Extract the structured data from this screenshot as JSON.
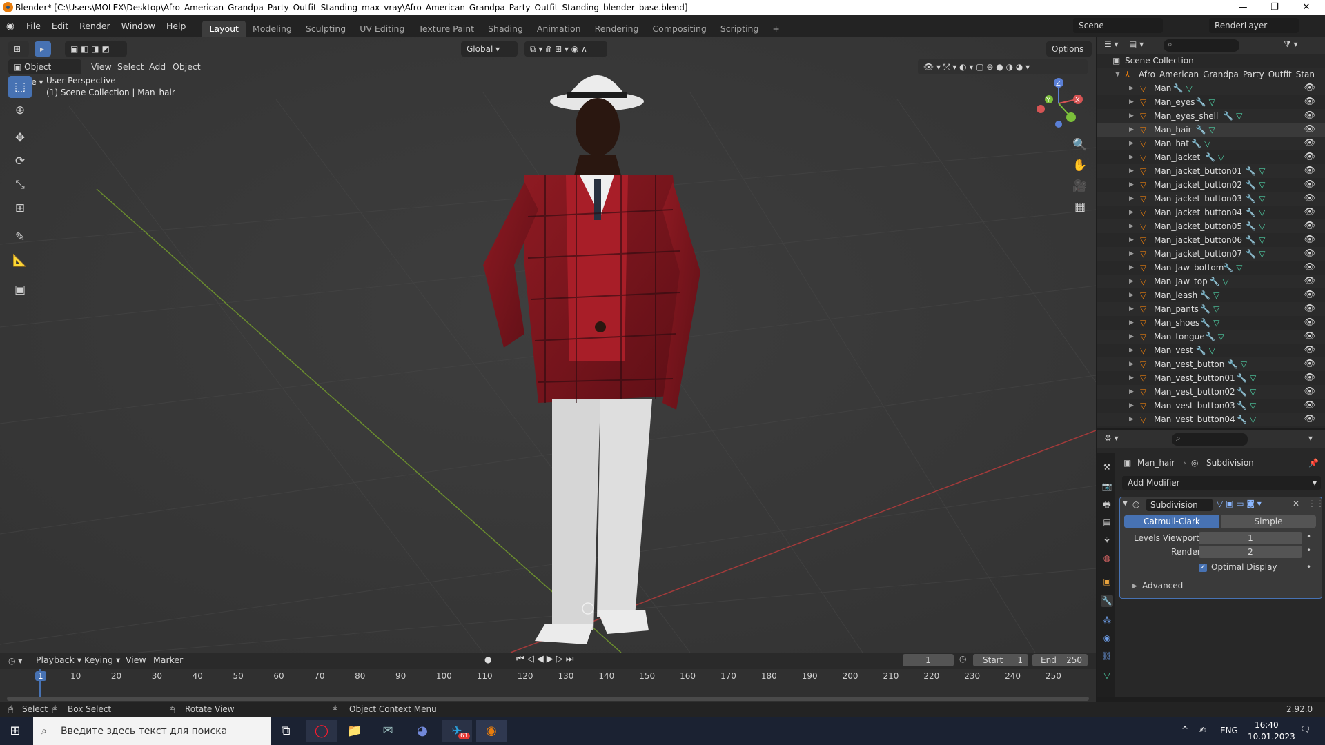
{
  "window": {
    "title": "Blender* [C:\\Users\\MOLEX\\Desktop\\Afro_American_Grandpa_Party_Outfit_Standing_max_vray\\Afro_American_Grandpa_Party_Outfit_Standing_blender_base.blend]",
    "minimize": "—",
    "maximize": "❐",
    "close": "✕"
  },
  "menu": {
    "items": [
      "File",
      "Edit",
      "Render",
      "Window",
      "Help"
    ],
    "workspaces": [
      "Layout",
      "Modeling",
      "Sculpting",
      "UV Editing",
      "Texture Paint",
      "Shading",
      "Animation",
      "Rendering",
      "Compositing",
      "Scripting"
    ],
    "add_workspace": "+",
    "scene": "Scene",
    "render_layer": "RenderLayer"
  },
  "viewport": {
    "orientation": "Global",
    "options": "Options",
    "mode": "Object Mode",
    "view_menu": [
      "View",
      "Select",
      "Add",
      "Object"
    ],
    "perspective": "User Perspective",
    "collection_info": "(1) Scene Collection | Man_hair",
    "gizmo": {
      "x": "X",
      "y": "Y",
      "z": "Z"
    }
  },
  "outliner": {
    "root": "Scene Collection",
    "collection": "Afro_American_Grandpa_Party_Outfit_Standi",
    "objects": [
      "Man",
      "Man_eyes",
      "Man_eyes_shell",
      "Man_hair",
      "Man_hat",
      "Man_jacket",
      "Man_jacket_button01",
      "Man_jacket_button02",
      "Man_jacket_button03",
      "Man_jacket_button04",
      "Man_jacket_button05",
      "Man_jacket_button06",
      "Man_jacket_button07",
      "Man_Jaw_bottom",
      "Man_Jaw_top",
      "Man_leash",
      "Man_pants",
      "Man_shoes",
      "Man_tongue",
      "Man_vest",
      "Man_vest_button",
      "Man_vest_button01",
      "Man_vest_button02",
      "Man_vest_button03",
      "Man_vest_button04"
    ],
    "selected": "Man_hair"
  },
  "properties": {
    "object": "Man_hair",
    "modifier_context": "Subdivision",
    "add_modifier": "Add Modifier",
    "modifier_name": "Subdivision",
    "catmull": "Catmull-Clark",
    "simple": "Simple",
    "levels_viewport_label": "Levels Viewport",
    "levels_viewport": "1",
    "render_label": "Render",
    "render": "2",
    "optimal_display": "Optimal Display",
    "advanced": "Advanced"
  },
  "timeline": {
    "menus": [
      "Playback",
      "Keying",
      "View",
      "Marker"
    ],
    "current_frame": "1",
    "start_label": "Start",
    "start": "1",
    "end_label": "End",
    "end": "250",
    "ticks": [
      "1",
      "10",
      "20",
      "30",
      "40",
      "50",
      "60",
      "70",
      "80",
      "90",
      "100",
      "110",
      "120",
      "130",
      "140",
      "150",
      "160",
      "170",
      "180",
      "190",
      "200",
      "210",
      "220",
      "230",
      "240",
      "250"
    ]
  },
  "status": {
    "select": "Select",
    "box_select": "Box Select",
    "rotate": "Rotate View",
    "context": "Object Context Menu",
    "version": "2.92.0"
  },
  "taskbar": {
    "search": "Введите здесь текст для поиска",
    "lang": "ENG",
    "time": "16:40",
    "date": "10.01.2023",
    "telegram_badge": "61"
  },
  "colors": {
    "accent": "#4772b3",
    "orange": "#e87d0d",
    "mesh": "#4fd1a6",
    "wrench": "#6e9ee8"
  }
}
